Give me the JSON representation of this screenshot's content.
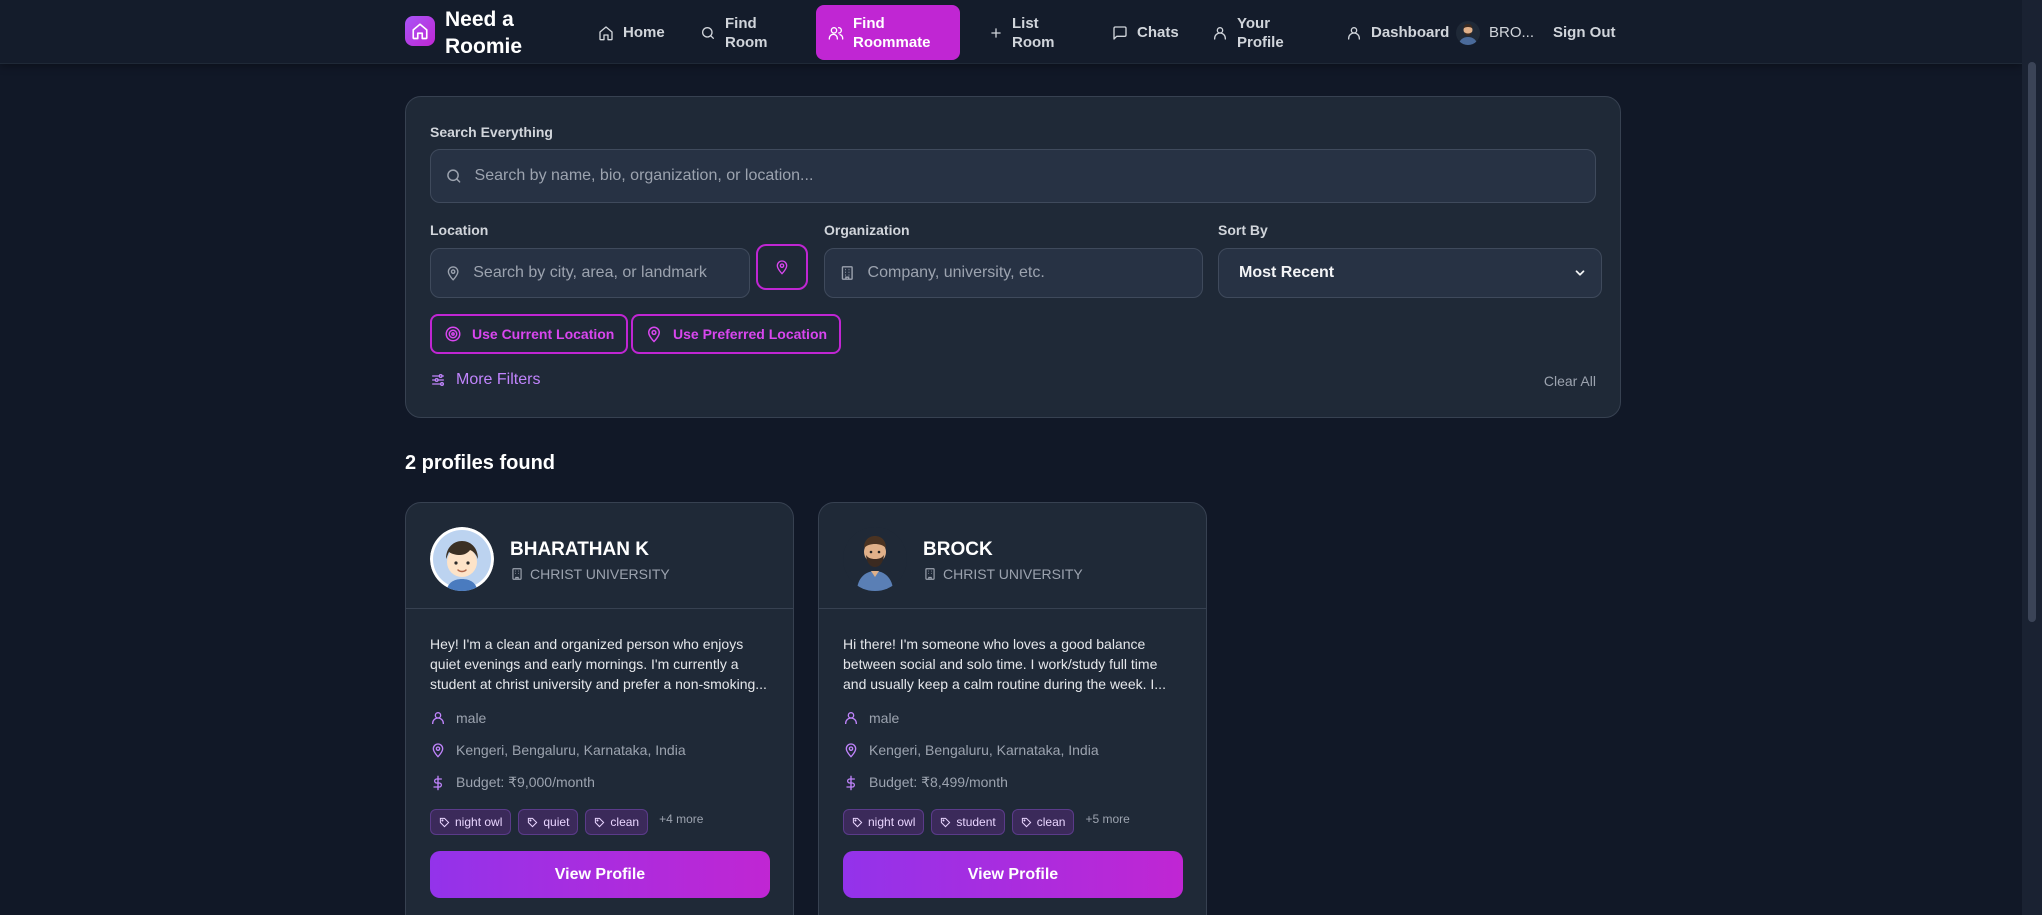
{
  "colors": {
    "accent": "#c026d3",
    "accent_purple": "#9333ea",
    "background": "#111827",
    "card": "#1f2937"
  },
  "nav": {
    "brand": "Need a Roomie",
    "items": [
      {
        "label": "Home",
        "icon": "home-icon"
      },
      {
        "label": "Find Room",
        "icon": "search-icon"
      },
      {
        "label": "Find Roommate",
        "icon": "users-icon",
        "active": true
      },
      {
        "label": "List Room",
        "icon": "plus-icon"
      },
      {
        "label": "Chats",
        "icon": "chat-icon"
      },
      {
        "label": "Your Profile",
        "icon": "user-icon"
      },
      {
        "label": "Dashboard",
        "icon": "user-icon"
      }
    ],
    "user_name": "BRO...",
    "sign_out": "Sign Out"
  },
  "search": {
    "label": "Search Everything",
    "placeholder": "Search by name, bio, organization, or location...",
    "location_label": "Location",
    "location_placeholder": "Search by city, area, or landmark",
    "organization_label": "Organization",
    "organization_placeholder": "Company, university, etc.",
    "sort_label": "Sort By",
    "sort_value": "Most Recent",
    "use_current_location": "Use Current Location",
    "use_preferred_location": "Use Preferred Location",
    "more_filters": "More Filters",
    "clear_all": "Clear All"
  },
  "results": {
    "count_text": "2 profiles found",
    "profiles": [
      {
        "name": "BHARATHAN K",
        "organization": "CHRIST UNIVERSITY",
        "bio": "Hey! I'm a clean and organized person who enjoys quiet evenings and early mornings. I'm currently a student at christ university and prefer a non-smoking...",
        "gender": "male",
        "location": "Kengeri, Bengaluru, Karnataka, India",
        "budget": "Budget: ₹9,000/month",
        "tags": [
          "night owl",
          "quiet",
          "clean"
        ],
        "more_tags": "+4 more",
        "button": "View Profile"
      },
      {
        "name": "BROCK",
        "organization": "CHRIST UNIVERSITY",
        "bio": "Hi there! I'm someone who loves a good balance between social and solo time. I work/study full time and usually keep a calm routine during the week. I...",
        "gender": "male",
        "location": "Kengeri, Bengaluru, Karnataka, India",
        "budget": "Budget: ₹8,499/month",
        "tags": [
          "night owl",
          "student",
          "clean"
        ],
        "more_tags": "+5 more",
        "button": "View Profile"
      }
    ]
  }
}
